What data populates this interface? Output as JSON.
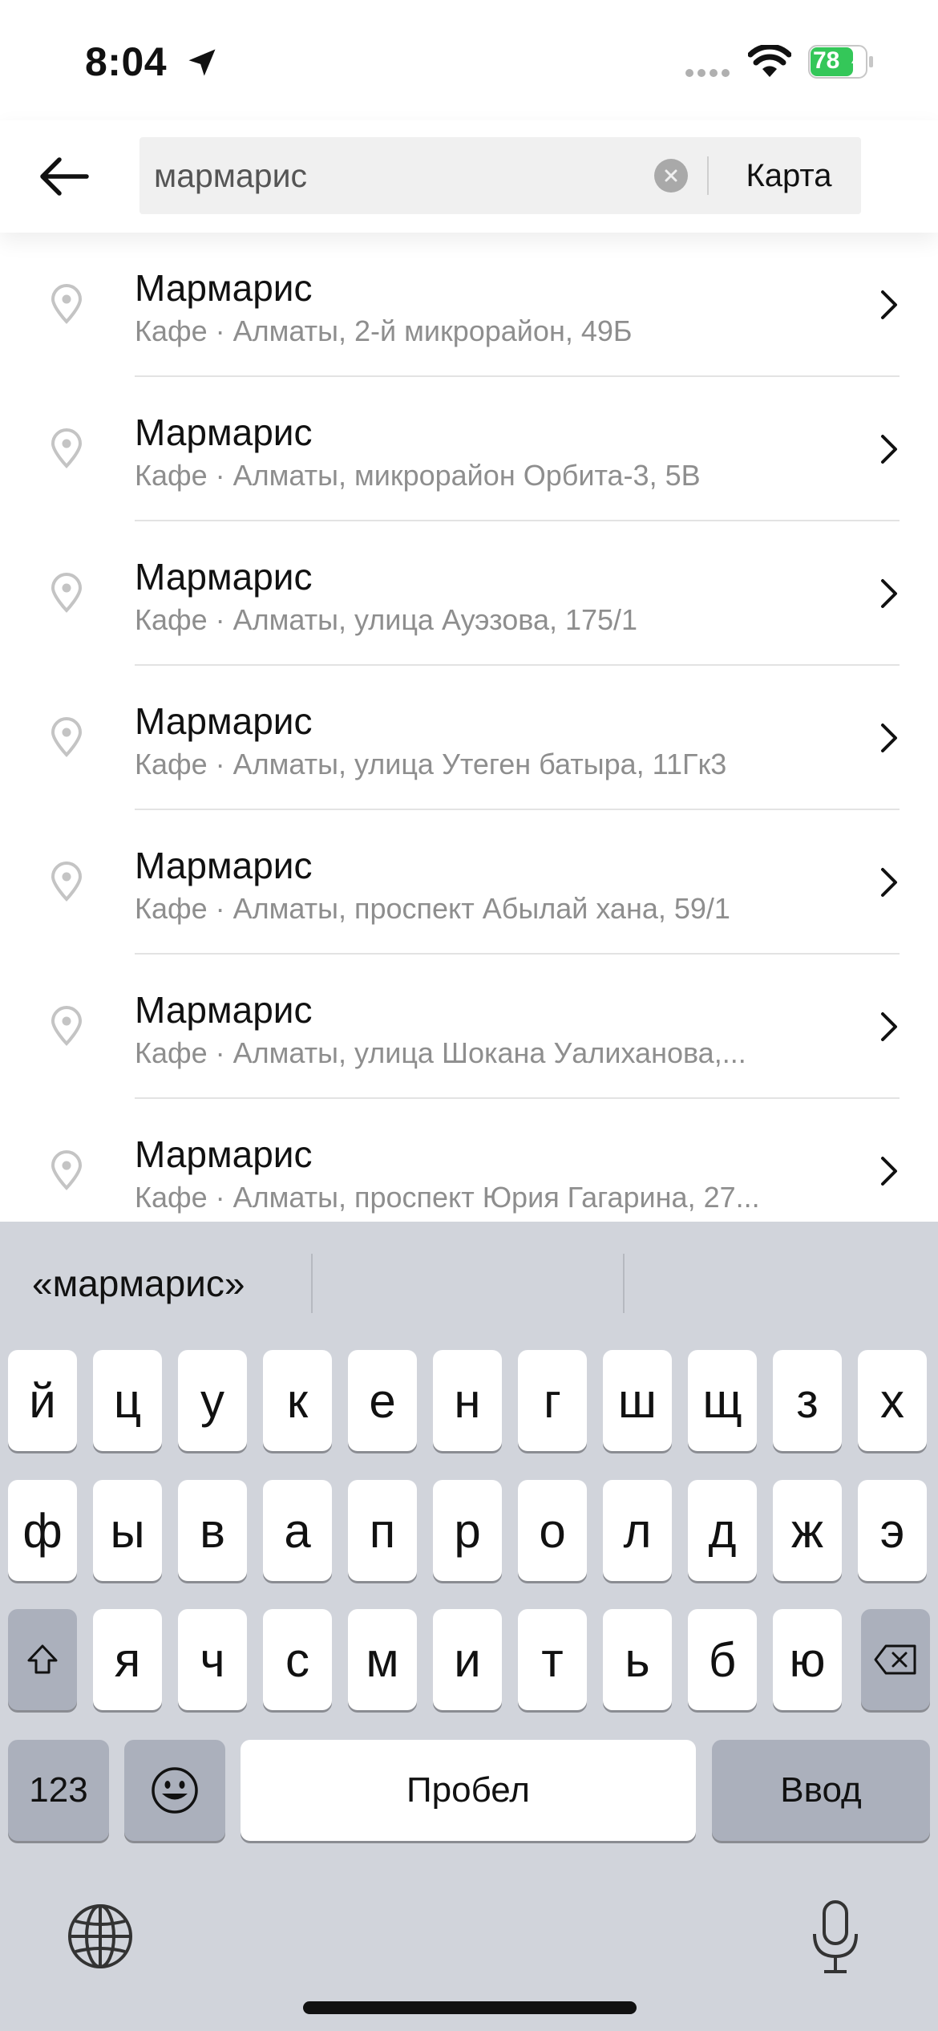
{
  "status_bar": {
    "time": "8:04",
    "battery_level": "78",
    "battery_color": "#34c759"
  },
  "search": {
    "query": "мармарис",
    "map_label": "Карта"
  },
  "results": [
    {
      "title": "Мармарис",
      "subtitle": "Кафе · Алматы, 2-й микрорайон, 49Б"
    },
    {
      "title": "Мармарис",
      "subtitle": "Кафе · Алматы, микрорайон Орбита-3, 5В"
    },
    {
      "title": "Мармарис",
      "subtitle": "Кафе · Алматы, улица Ауэзова, 175/1"
    },
    {
      "title": "Мармарис",
      "subtitle": "Кафе · Алматы, улица Утеген батыра, 11Гк3"
    },
    {
      "title": "Мармарис",
      "subtitle": "Кафе · Алматы, проспект Абылай хана, 59/1"
    },
    {
      "title": "Мармарис",
      "subtitle": "Кафе · Алматы, улица Шокана Уалиханова,..."
    },
    {
      "title": "Мармарис",
      "subtitle": "Кафе · Алматы, проспект Юрия Гагарина, 27..."
    }
  ],
  "keyboard": {
    "prediction": "«мармарис»",
    "row1": [
      "й",
      "ц",
      "у",
      "к",
      "е",
      "н",
      "г",
      "ш",
      "щ",
      "з",
      "х"
    ],
    "row2": [
      "ф",
      "ы",
      "в",
      "а",
      "п",
      "р",
      "о",
      "л",
      "д",
      "ж",
      "э"
    ],
    "row3": [
      "я",
      "ч",
      "с",
      "м",
      "и",
      "т",
      "ь",
      "б",
      "ю"
    ],
    "numbers_label": "123",
    "space_label": "Пробел",
    "return_label": "Ввод",
    "icons": {
      "shift": "shift-icon",
      "delete": "delete-icon",
      "emoji": "emoji-icon",
      "globe": "globe-icon",
      "mic": "microphone-icon"
    }
  }
}
